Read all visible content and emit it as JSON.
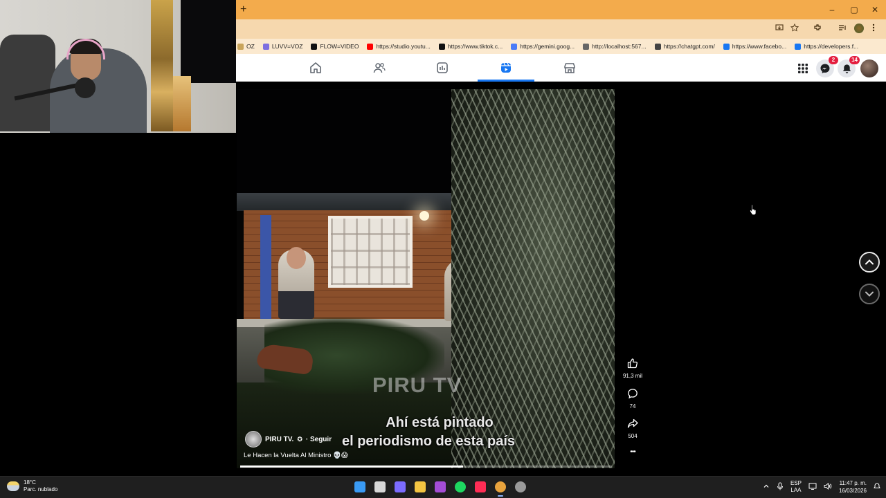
{
  "browser": {
    "new_tab_symbol": "+",
    "window_controls": {
      "minimize": "–",
      "maximize": "▢",
      "close": "✕"
    },
    "accent_color": "#f3ab4c",
    "bookmarks": [
      {
        "label": "OZ",
        "icon": "folder-icon",
        "color": "#c9a45a"
      },
      {
        "label": "LUVV=VOZ",
        "icon": "audio-icon",
        "color": "#7d6fe0"
      },
      {
        "label": "FLOW=VIDEO",
        "icon": "flow-icon",
        "color": "#111111"
      },
      {
        "label": "https://studio.youtu...",
        "icon": "youtube-icon",
        "color": "#ff0000"
      },
      {
        "label": "https://www.tiktok.c...",
        "icon": "tiktok-icon",
        "color": "#111111"
      },
      {
        "label": "https://gemini.goog...",
        "icon": "gemini-icon",
        "color": "#4a7bf7"
      },
      {
        "label": "http://localhost:567...",
        "icon": "globe-icon",
        "color": "#666666"
      },
      {
        "label": "https://chatgpt.com/",
        "icon": "chatgpt-icon",
        "color": "#444444"
      },
      {
        "label": "https://www.facebo...",
        "icon": "facebook-icon",
        "color": "#1877f2"
      },
      {
        "label": "https://developers.f...",
        "icon": "facebook-icon",
        "color": "#1877f2"
      }
    ]
  },
  "facebook": {
    "accent_color": "#1877f2",
    "tabs": [
      {
        "name": "home",
        "icon": "home-icon",
        "active": false
      },
      {
        "name": "friends",
        "icon": "friends-icon",
        "active": false
      },
      {
        "name": "watch",
        "icon": "video-icon",
        "active": false
      },
      {
        "name": "reels",
        "icon": "reels-icon",
        "active": true
      },
      {
        "name": "marketplace",
        "icon": "marketplace-icon",
        "active": false
      }
    ],
    "right": {
      "menu_icon": "grid-menu-icon",
      "messenger_badge": "2",
      "notifications_badge": "14"
    }
  },
  "reel": {
    "watermark": "PIRU TV",
    "subtitle_line1": "Ahí está pintado",
    "subtitle_line2": "el periodismo de esta país",
    "author": "PIRU TV.",
    "verified_symbol": "✪",
    "follow_label": "· Seguir",
    "caption": "Le Hacen la Vuelta Al Ministro 💀😱",
    "progress": 0.6,
    "likes": "91,3 mil",
    "comments": "74",
    "shares": "504",
    "more": "•••"
  },
  "taskbar": {
    "weather_temp": "18°C",
    "weather_desc": "Parc. nublado",
    "apps": [
      {
        "name": "start",
        "icon": "windows-icon",
        "color": "#3a9bf5",
        "active": false
      },
      {
        "name": "task-view",
        "icon": "taskview-icon",
        "color": "#d8d8d8",
        "active": false
      },
      {
        "name": "copilot",
        "icon": "copilot-icon",
        "color": "#7c6cff",
        "active": false
      },
      {
        "name": "file-explorer",
        "icon": "folder-icon",
        "color": "#f4c542",
        "active": false
      },
      {
        "name": "app-purple",
        "icon": "app-icon",
        "color": "#a44dd6",
        "active": false
      },
      {
        "name": "spotify",
        "icon": "spotify-icon",
        "color": "#1ed760",
        "active": false
      },
      {
        "name": "tiktok",
        "icon": "tiktok-icon",
        "color": "#ff2d55",
        "active": false
      },
      {
        "name": "chrome",
        "icon": "chrome-icon",
        "color": "#e8a33d",
        "active": true
      },
      {
        "name": "recorder",
        "icon": "record-icon",
        "color": "#9a9a9a",
        "active": false
      }
    ],
    "language_line1": "ESP",
    "language_line2": "LAA",
    "time": "11:47 p. m.",
    "date": "16/03/2026"
  }
}
